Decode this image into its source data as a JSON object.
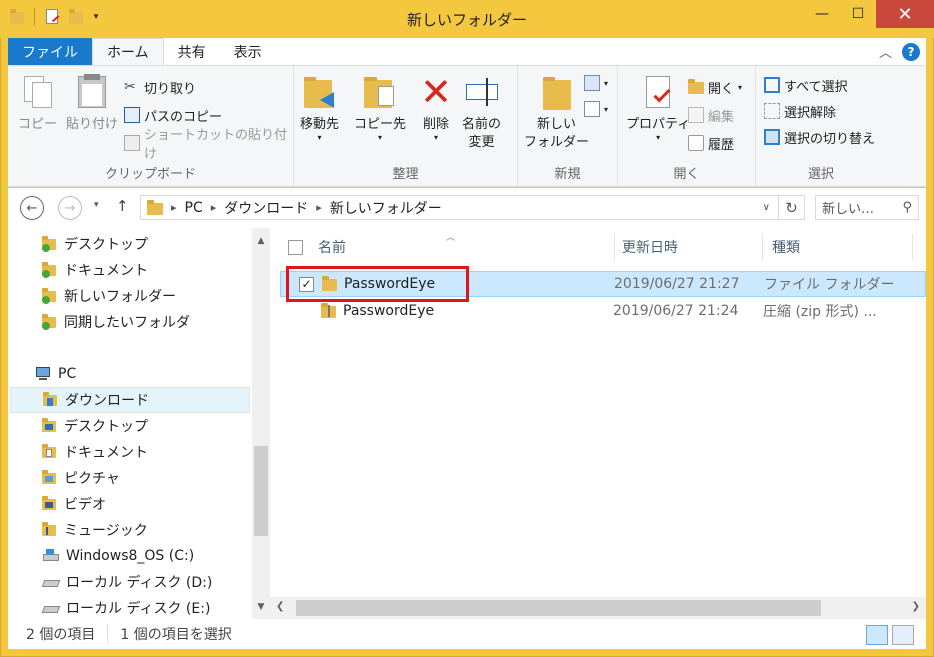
{
  "window": {
    "title": "新しいフォルダー",
    "minimize": "—",
    "maximize": "☐",
    "close": "✕"
  },
  "ribbon_tabs": [
    "ファイル",
    "ホーム",
    "共有",
    "表示"
  ],
  "ribbon": {
    "clipboard": {
      "copy": "コピー",
      "paste": "貼り付け",
      "cut": "切り取り",
      "copy_path": "パスのコピー",
      "paste_shortcut": "ショートカットの貼り付け",
      "label": "クリップボード"
    },
    "organize": {
      "move_to": "移動先",
      "copy_to": "コピー先",
      "delete": "削除",
      "rename_1": "名前の",
      "rename_2": "変更",
      "label": "整理"
    },
    "new": {
      "new_folder_1": "新しい",
      "new_folder_2": "フォルダー",
      "label": "新規"
    },
    "open": {
      "properties": "プロパティ",
      "open": "開く",
      "edit": "編集",
      "history": "履歴",
      "label": "開く"
    },
    "select": {
      "select_all": "すべて選択",
      "select_none": "選択解除",
      "invert": "選択の切り替え",
      "label": "選択"
    }
  },
  "address": {
    "segments": [
      "PC",
      "ダウンロード",
      "新しいフォルダー"
    ],
    "search_placeholder": "新しい…"
  },
  "nav": {
    "favorites": [
      "デスクトップ",
      "ドキュメント",
      "新しいフォルダー",
      "同期したいフォルダ"
    ],
    "pc_label": "PC",
    "pc_items": [
      "ダウンロード",
      "デスクトップ",
      "ドキュメント",
      "ピクチャ",
      "ビデオ",
      "ミュージック",
      "Windows8_OS (C:)",
      "ローカル ディスク (D:)",
      "ローカル ディスク (E:)"
    ],
    "selected": "ダウンロード"
  },
  "columns": {
    "name": "名前",
    "modified": "更新日時",
    "type": "種類"
  },
  "files": [
    {
      "name": "PasswordEye",
      "modified": "2019/06/27 21:27",
      "type": "ファイル フォルダー",
      "selected": true,
      "checked": true
    },
    {
      "name": "PasswordEye",
      "modified": "2019/06/27 21:24",
      "type": "圧縮 (zip 形式) ...",
      "selected": false
    }
  ],
  "status": {
    "count": "2 個の項目",
    "selection": "1 個の項目を選択"
  },
  "colors": {
    "frame": "#f3c83f",
    "file_tab": "#1979ca",
    "selected_row": "#cce8ff",
    "highlight_box": "#e0141a"
  }
}
